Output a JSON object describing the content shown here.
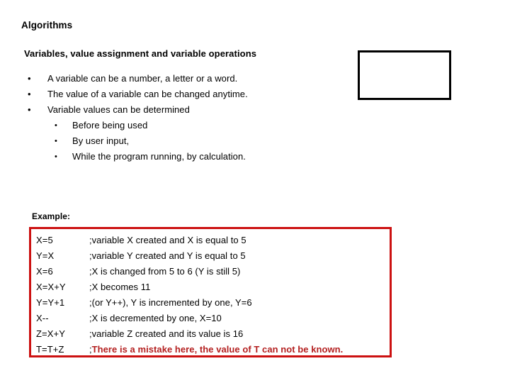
{
  "slide": {
    "title": "Algorithms",
    "subtitle": "Variables, value assignment and variable operations",
    "bullets": [
      {
        "level": 1,
        "marker": "•",
        "text": "A variable can be a number, a letter or a word."
      },
      {
        "level": 1,
        "marker": "•",
        "text": "The value of a variable can be changed anytime."
      },
      {
        "level": 1,
        "marker": "•",
        "text": "Variable values can be determined"
      },
      {
        "level": 2,
        "marker": "•",
        "text": "Before being used"
      },
      {
        "level": 2,
        "marker": "•",
        "text": "By user input,"
      },
      {
        "level": 2,
        "marker": "•",
        "text": "While the program running, by calculation."
      }
    ],
    "example_label": "Example:",
    "code_lines": [
      {
        "expr": "X=5",
        "semi": ";",
        "comment": " variable X created and X is equal to 5",
        "error": false
      },
      {
        "expr": "Y=X",
        "semi": ";",
        "comment": " variable Y created and Y is equal to 5",
        "error": false
      },
      {
        "expr": "X=6",
        "semi": ";",
        "comment": " X is changed from 5 to 6 (Y is still 5)",
        "error": false
      },
      {
        "expr": "X=X+Y",
        "semi": ";",
        "comment": "X becomes 11",
        "error": false
      },
      {
        "expr": "Y=Y+1",
        "semi": ";",
        "comment": " (or Y++), Y is incremented by one, Y=6",
        "error": false
      },
      {
        "expr": "X--",
        "semi": ";",
        "comment": " X is decremented by one, X=10",
        "error": false
      },
      {
        "expr": "Z=X+Y",
        "semi": ";",
        "comment": " variable Z created and its value is 16",
        "error": false
      },
      {
        "expr": "T=T+Z",
        "semi": ";",
        "comment": " There is a mistake here, the value of T can not be known.",
        "error": true
      }
    ],
    "colors": {
      "code_box_border": "#CC1111",
      "error_text": "#B42020",
      "placeholder_border": "#000000",
      "background": "#FFFFFF"
    }
  }
}
